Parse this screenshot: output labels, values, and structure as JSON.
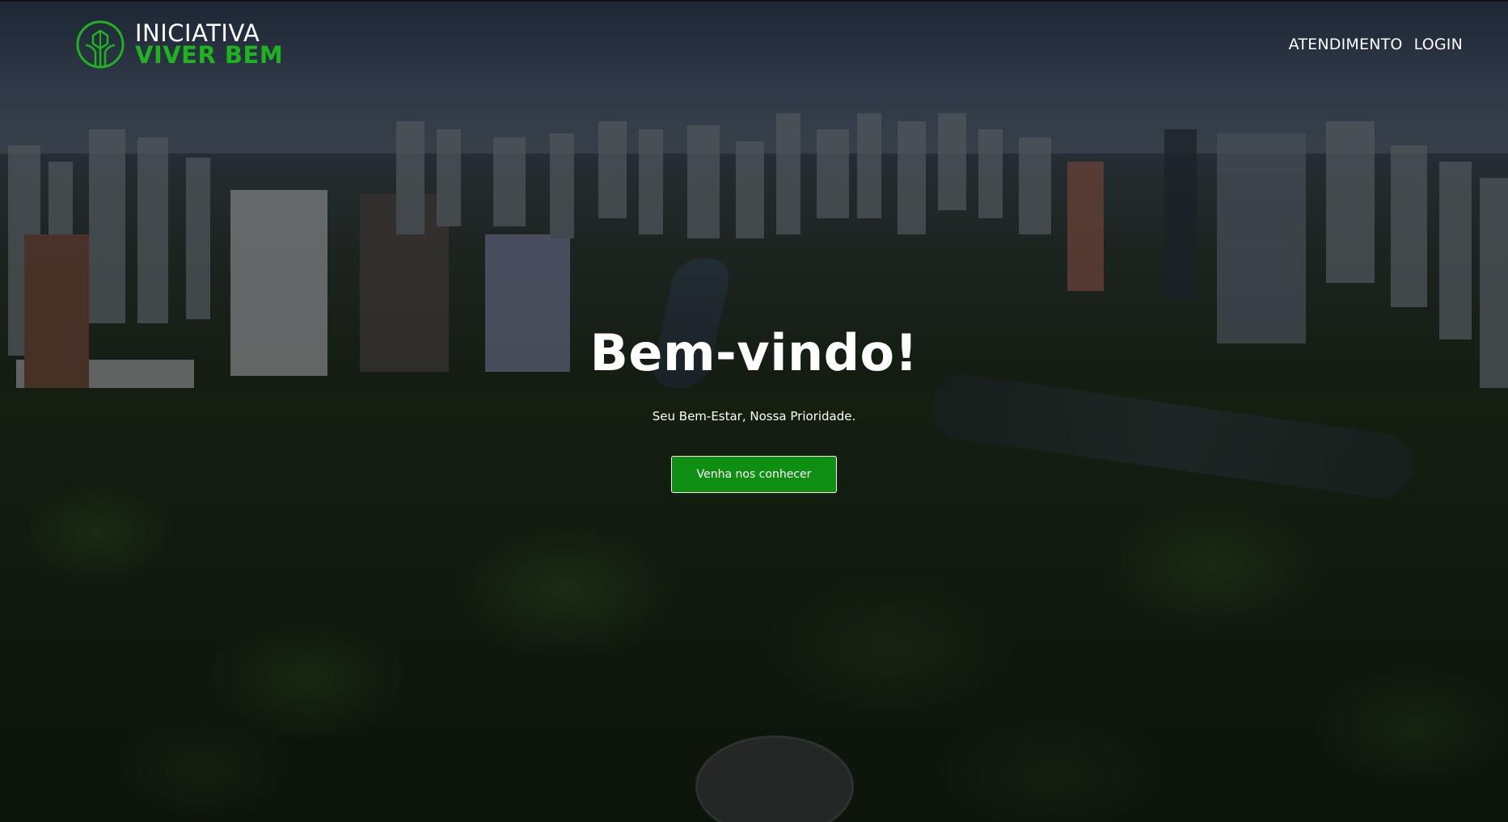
{
  "header": {
    "logo": {
      "line1": "INICIATIVA",
      "line2": "VIVER BEM",
      "icon": "plant-leaf-icon"
    },
    "nav": [
      {
        "label": "ATENDIMENTO"
      },
      {
        "label": "LOGIN"
      }
    ]
  },
  "hero": {
    "title": "Bem-vindo!",
    "subtitle": "Seu Bem-Estar, Nossa Prioridade.",
    "cta_label": "Venha nos conhecer"
  },
  "colors": {
    "brand_green": "#1fb31f",
    "button_green": "#0e8f12",
    "text": "#ffffff"
  }
}
